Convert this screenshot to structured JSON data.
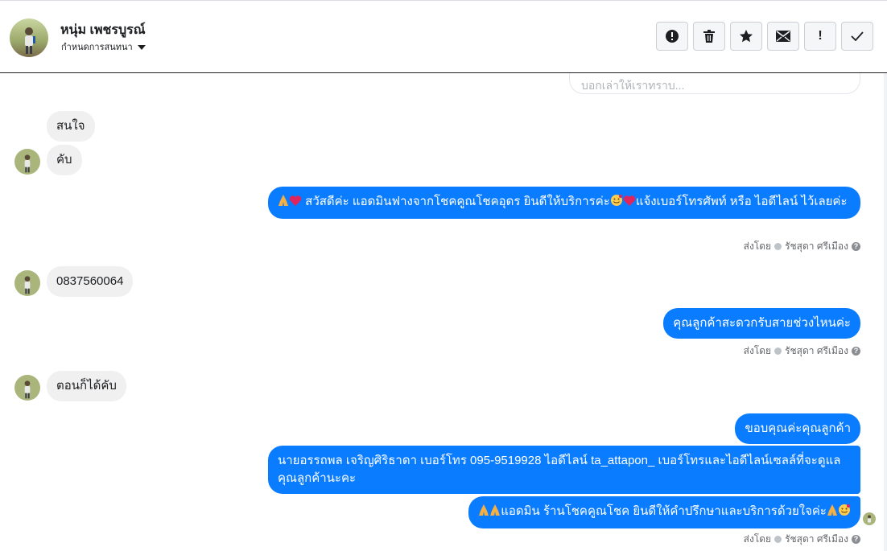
{
  "header": {
    "name": "หนุ่ม เพชรบูรณ์",
    "subtitle": "กำหนดการสนทนา",
    "actions": [
      {
        "icon": "alert-circle-icon"
      },
      {
        "icon": "trash-icon"
      },
      {
        "icon": "star-icon"
      },
      {
        "icon": "envelope-icon"
      },
      {
        "icon": "exclamation-icon",
        "label": "!"
      },
      {
        "icon": "check-icon"
      }
    ]
  },
  "composer": {
    "placeholder": "บอกเล่าให้เราทราบ..."
  },
  "messages": {
    "m1": "สนใจ",
    "m2": "คับ",
    "m3": "สวัสดีค่ะ แอดมินฟางจากโชคคูณโชคอุดร ยินดีให้บริการค่ะ",
    "m3b": "แจ้งเบอร์โทรศัพท์ หรือ ไอดีไลน์  ไว้เลยค่ะ",
    "m4": "0837560064",
    "m5": "คุณลูกค้าสะดวกรับสายช่วงไหนค่ะ",
    "m6": "ตอนก็ได้คับ",
    "m7": "ขอบคุณค่ะคุณลูกค้า",
    "m8": "นายอรรถพล เจริญศิริธาดา     เบอร์โทร 095-9519928 ไอดีไลน์ ta_attapon_   เบอร์โทรและไอดีไลน์เซลล์ที่จะดูแลคุณลูกค้านะคะ",
    "m9a": "แอดมิน ร้านโชคคูณโชค ยินดีให้คำปรึกษาและบริการด้วยใจค่ะ"
  },
  "meta": {
    "sent_by": "ส่งโดย",
    "agent": "รัชสุดา ศรีเมือง"
  },
  "colors": {
    "outgoing": "#0a7cff",
    "incoming": "#f0f0f0"
  }
}
